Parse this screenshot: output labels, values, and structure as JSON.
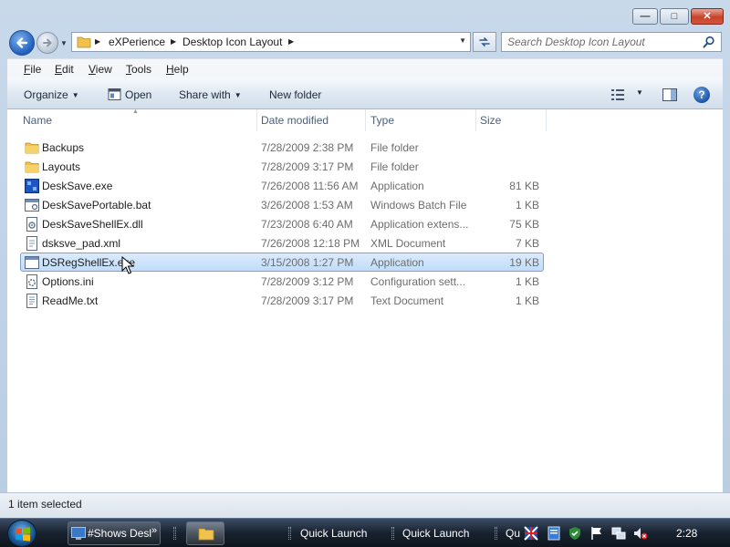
{
  "window": {
    "controls": {
      "minimize": "—",
      "maximize": "□",
      "close": "✕"
    }
  },
  "address": {
    "breadcrumbs": [
      "eXPerience",
      "Desktop Icon Layout"
    ],
    "search_placeholder": "Search Desktop Icon Layout"
  },
  "menu": {
    "items": [
      {
        "label": "File",
        "accel": "F",
        "rest": "ile"
      },
      {
        "label": "Edit",
        "accel": "E",
        "rest": "dit"
      },
      {
        "label": "View",
        "accel": "V",
        "rest": "iew"
      },
      {
        "label": "Tools",
        "accel": "T",
        "rest": "ools"
      },
      {
        "label": "Help",
        "accel": "H",
        "rest": "elp"
      }
    ]
  },
  "toolbar": {
    "organize": "Organize",
    "open": "Open",
    "share_with": "Share with",
    "new_folder": "New folder",
    "help": "?"
  },
  "columns": {
    "name": "Name",
    "date_modified": "Date modified",
    "type": "Type",
    "size": "Size"
  },
  "files": [
    {
      "name": "Backups",
      "date": "7/28/2009 2:38 PM",
      "type": "File folder",
      "size": "",
      "icon": "folder-icon"
    },
    {
      "name": "Layouts",
      "date": "7/28/2009 3:17 PM",
      "type": "File folder",
      "size": "",
      "icon": "folder-icon"
    },
    {
      "name": "DeskSave.exe",
      "date": "7/26/2008 11:56 AM",
      "type": "Application",
      "size": "81 KB",
      "icon": "app-icon"
    },
    {
      "name": "DeskSavePortable.bat",
      "date": "3/26/2008 1:53 AM",
      "type": "Windows Batch File",
      "size": "1 KB",
      "icon": "batch-icon"
    },
    {
      "name": "DeskSaveShellEx.dll",
      "date": "7/23/2008 6:40 AM",
      "type": "Application extens...",
      "size": "75 KB",
      "icon": "dll-icon"
    },
    {
      "name": "dsksve_pad.xml",
      "date": "7/26/2008 12:18 PM",
      "type": "XML Document",
      "size": "7 KB",
      "icon": "xml-icon"
    },
    {
      "name": "DSRegShellEx.exe",
      "date": "3/15/2008 1:27 PM",
      "type": "Application",
      "size": "19 KB",
      "icon": "exe-icon",
      "selected": true
    },
    {
      "name": "Options.ini",
      "date": "7/28/2009 3:12 PM",
      "type": "Configuration sett...",
      "size": "1 KB",
      "icon": "ini-icon"
    },
    {
      "name": "ReadMe.txt",
      "date": "7/28/2009 3:17 PM",
      "type": "Text Document",
      "size": "1 KB",
      "icon": "text-icon"
    }
  ],
  "status": {
    "text": "1 item selected"
  },
  "taskbar": {
    "task1_label": "#Shows Desl",
    "quick_launch_1": "Quick Launch",
    "quick_launch_2": "Quick Launch",
    "qu_label": "Qu",
    "clock": "2:28"
  },
  "colors": {
    "selection_bg": "#cce1fa",
    "selection_border": "#7da2ce",
    "folder": "#f0c24b",
    "taskbar": "#18222f"
  }
}
